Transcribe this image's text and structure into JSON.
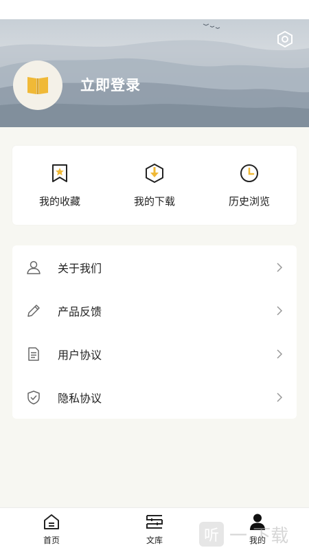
{
  "header": {
    "login_label": "立即登录",
    "settings_icon": "hexagon-settings-icon",
    "avatar_icon": "open-book-icon",
    "accent": "#f0b937"
  },
  "quick_actions": [
    {
      "label": "我的收藏",
      "icon": "bookmark-star-icon"
    },
    {
      "label": "我的下载",
      "icon": "download-hexagon-icon"
    },
    {
      "label": "历史浏览",
      "icon": "clock-icon"
    }
  ],
  "menu": [
    {
      "label": "关于我们",
      "icon": "user-icon"
    },
    {
      "label": "产品反馈",
      "icon": "pencil-icon"
    },
    {
      "label": "用户协议",
      "icon": "document-icon"
    },
    {
      "label": "隐私协议",
      "icon": "shield-check-icon"
    }
  ],
  "tabs": [
    {
      "label": "首页",
      "icon": "home-icon",
      "active": false
    },
    {
      "label": "文库",
      "icon": "library-icon",
      "active": false
    },
    {
      "label": "我的",
      "icon": "person-icon",
      "active": true
    }
  ],
  "watermark": {
    "text": "一 下载",
    "badge": "听"
  }
}
